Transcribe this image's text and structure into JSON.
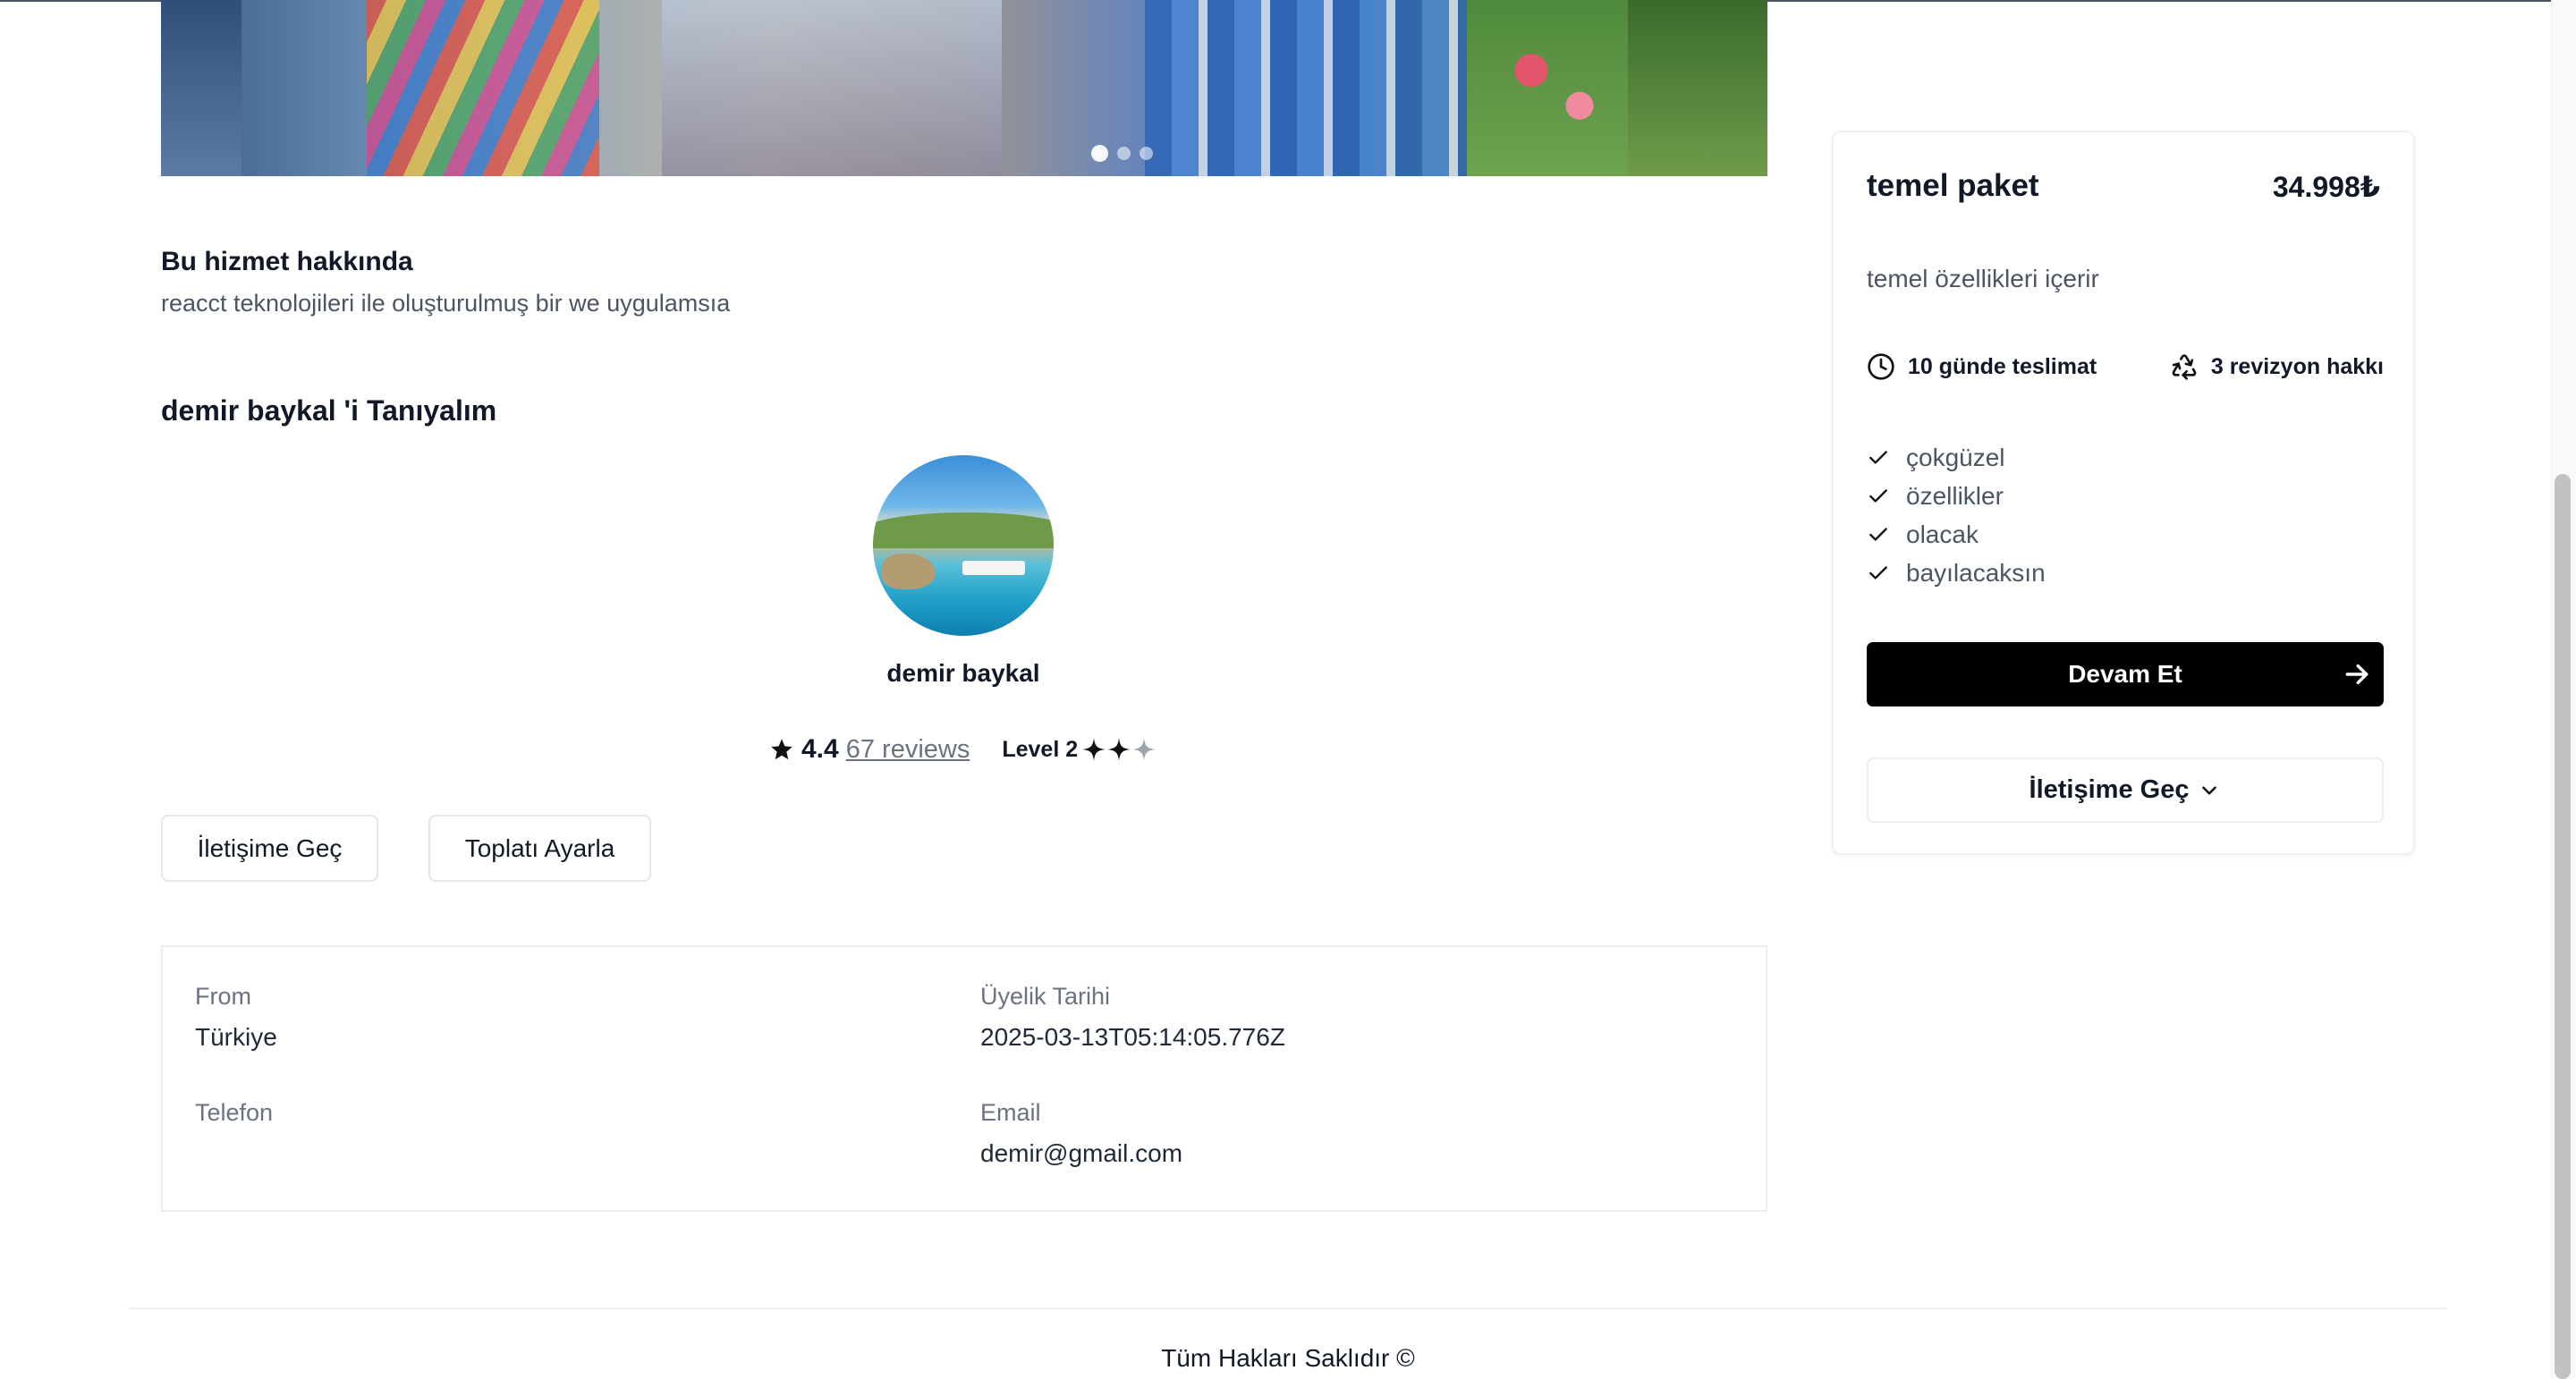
{
  "hero": {
    "slides_total": 3,
    "active_slide": 1
  },
  "about": {
    "title": "Bu hizmet hakkında",
    "text": "reacct teknolojileri ile oluşturulmuş bir we uygulamsıa"
  },
  "seller": {
    "intro_title": "demir baykal 'i Tanıyalım",
    "name": "demir baykal",
    "rating": "4.4",
    "reviews_label": "67 reviews",
    "level_label": "Level 2",
    "level_filled": 2,
    "level_total": 3,
    "contact_button": "İletişime Geç",
    "meeting_button": "Toplatı Ayarla"
  },
  "info": {
    "from_label": "From",
    "from_value": "Türkiye",
    "member_since_label": "Üyelik Tarihi",
    "member_since_value": "2025-03-13T05:14:05.776Z",
    "phone_label": "Telefon",
    "phone_value": "",
    "email_label": "Email",
    "email_value": "demir@gmail.com"
  },
  "package": {
    "title": "temel paket",
    "price": "34.998₺",
    "description": "temel özellikleri içerir",
    "delivery": "10 günde teslimat",
    "revisions": "3 revizyon hakkı",
    "features": [
      "çokgüzel",
      "özellikler",
      "olacak",
      "bayılacaksın"
    ],
    "continue_button": "Devam Et",
    "contact_button": "İletişime Geç"
  },
  "footer": {
    "text": "Tüm Hakları Saklıdır ©"
  },
  "icons": {
    "star": "star-icon",
    "level": "sparkle-icon",
    "clock": "clock-icon",
    "revision": "recycle-icon",
    "check": "check-icon",
    "arrow": "arrow-right-icon",
    "chevron": "chevron-down-icon"
  },
  "colors": {
    "primary_button": "#000000",
    "muted_text": "#6b7280",
    "border": "#eceef1"
  }
}
